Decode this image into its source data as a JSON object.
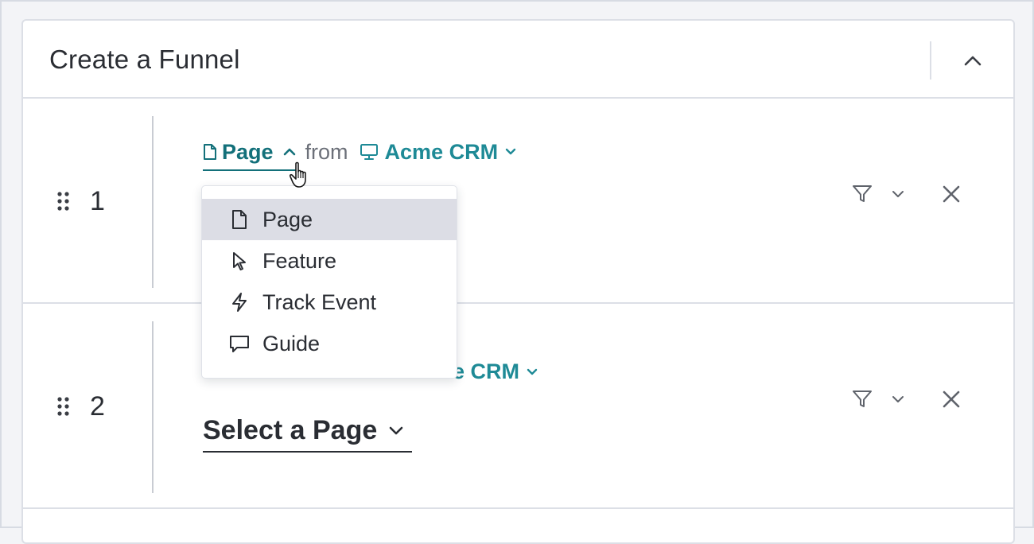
{
  "card": {
    "title": "Create a Funnel"
  },
  "steps": [
    {
      "number": "1",
      "type_label": "Page",
      "from_label": "from",
      "app_label": "Acme CRM"
    },
    {
      "number": "2",
      "app_label_partial": "e CRM",
      "select_label": "Select a Page"
    }
  ],
  "dropdown": {
    "items": [
      {
        "label": "Page",
        "icon": "page-icon",
        "selected": true
      },
      {
        "label": "Feature",
        "icon": "pointer-icon",
        "selected": false
      },
      {
        "label": "Track Event",
        "icon": "lightning-icon",
        "selected": false
      },
      {
        "label": "Guide",
        "icon": "speech-bubble-icon",
        "selected": false
      }
    ]
  },
  "colors": {
    "accent_dark": "#13707a",
    "accent": "#1e8a96",
    "text": "#2a2d33",
    "muted": "#6c7079",
    "menu_highlight": "#dcdde5"
  }
}
